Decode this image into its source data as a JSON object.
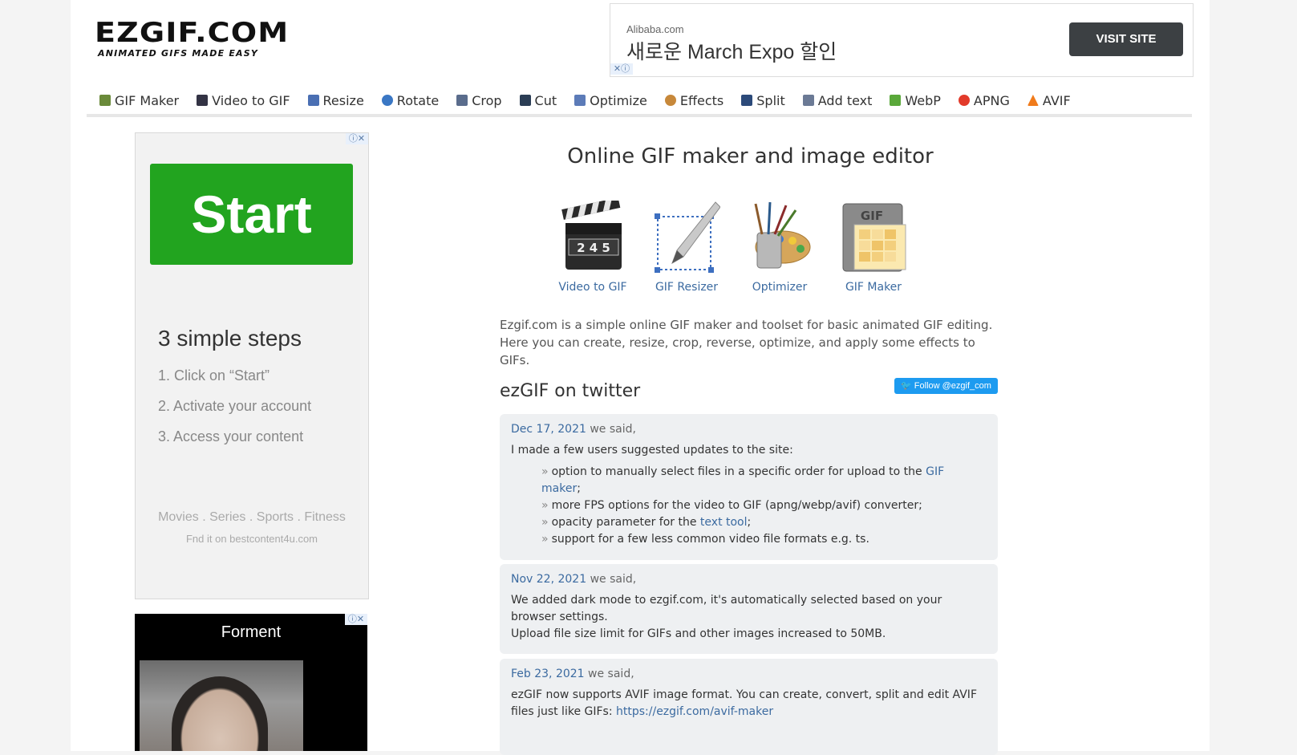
{
  "logo": {
    "main": "EZGIF.COM",
    "tagline": "ANIMATED GIFS MADE EASY"
  },
  "top_ad": {
    "source": "Alibaba.com",
    "title": "새로운 March Expo 할인",
    "button": "VISIT SITE",
    "marks": "✕ⓘ"
  },
  "nav": [
    {
      "label": "GIF Maker",
      "icon": "gif-maker-icon",
      "color": "#6a8a3a"
    },
    {
      "label": "Video to GIF",
      "icon": "film-icon",
      "color": "#334"
    },
    {
      "label": "Resize",
      "icon": "resize-icon",
      "color": "#4a6fb3"
    },
    {
      "label": "Rotate",
      "icon": "rotate-icon",
      "color": "#3a77c4"
    },
    {
      "label": "Crop",
      "icon": "crop-icon",
      "color": "#5a6c8c"
    },
    {
      "label": "Cut",
      "icon": "cut-icon",
      "color": "#2b3d55"
    },
    {
      "label": "Optimize",
      "icon": "optimize-icon",
      "color": "#5c7bb8"
    },
    {
      "label": "Effects",
      "icon": "effects-icon",
      "color": "#c7883a"
    },
    {
      "label": "Split",
      "icon": "split-icon",
      "color": "#2c4a7a"
    },
    {
      "label": "Add text",
      "icon": "add-text-icon",
      "color": "#6b7a95"
    },
    {
      "label": "WebP",
      "icon": "webp-icon",
      "color": "#5aa83a"
    },
    {
      "label": "APNG",
      "icon": "apng-icon",
      "color": "#e23a2a"
    },
    {
      "label": "AVIF",
      "icon": "avif-icon",
      "color": "#f07b1b"
    }
  ],
  "left_ad1": {
    "start": "Start",
    "heading": "3 simple steps",
    "steps": [
      "1. Click on “Start”",
      "2. Activate your account",
      "3. Access your content"
    ],
    "categories": "Movies . Series . Sports . Fitness",
    "find": "Fnd it on bestcontent4u.com",
    "marks": "ⓘ✕"
  },
  "left_ad2": {
    "brand": "Forment",
    "marks": "ⓘ✕"
  },
  "main": {
    "title": "Online GIF maker and image editor",
    "tools": [
      {
        "label": "Video to GIF",
        "icon": "clapperboard-icon"
      },
      {
        "label": "GIF Resizer",
        "icon": "resize-pen-icon"
      },
      {
        "label": "Optimizer",
        "icon": "paint-palette-icon"
      },
      {
        "label": "GIF Maker",
        "icon": "gif-file-icon"
      }
    ],
    "clapper_numbers": "2 4 5",
    "gif_badge": "GIF",
    "intro_line1": "Ezgif.com is a simple online GIF maker and toolset for basic animated GIF editing.",
    "intro_line2": "Here you can create, resize, crop, reverse, optimize, and apply some effects to GIFs."
  },
  "twitter": {
    "title": "ezGIF on twitter",
    "follow": "Follow @ezgif_com",
    "posts": [
      {
        "date": "Dec 17, 2021",
        "said": "we said,",
        "text": "I made a few users suggested updates to the site:",
        "items": [
          {
            "pre": "option to manually select files in a specific order for upload to the ",
            "link": "GIF maker",
            "post": ";"
          },
          {
            "pre": "more FPS options for the video to GIF (apng/webp/avif) converter;",
            "link": "",
            "post": ""
          },
          {
            "pre": "opacity parameter for the ",
            "link": "text tool",
            "post": ";"
          },
          {
            "pre": "support for a few less common video file formats e.g. ts.",
            "link": "",
            "post": ""
          }
        ]
      },
      {
        "date": "Nov 22, 2021",
        "said": "we said,",
        "text1": "We added dark mode to ezgif.com, it's automatically selected based on your browser settings.",
        "text2": "Upload file size limit for GIFs and other images increased to 50MB."
      },
      {
        "date": "Feb 23, 2021",
        "said": "we said,",
        "text": "ezGIF now supports AVIF image format. You can create, convert, split and edit AVIF files just like GIFs: ",
        "link": "https://ezgif.com/avif-maker"
      }
    ]
  },
  "bullet": "»"
}
